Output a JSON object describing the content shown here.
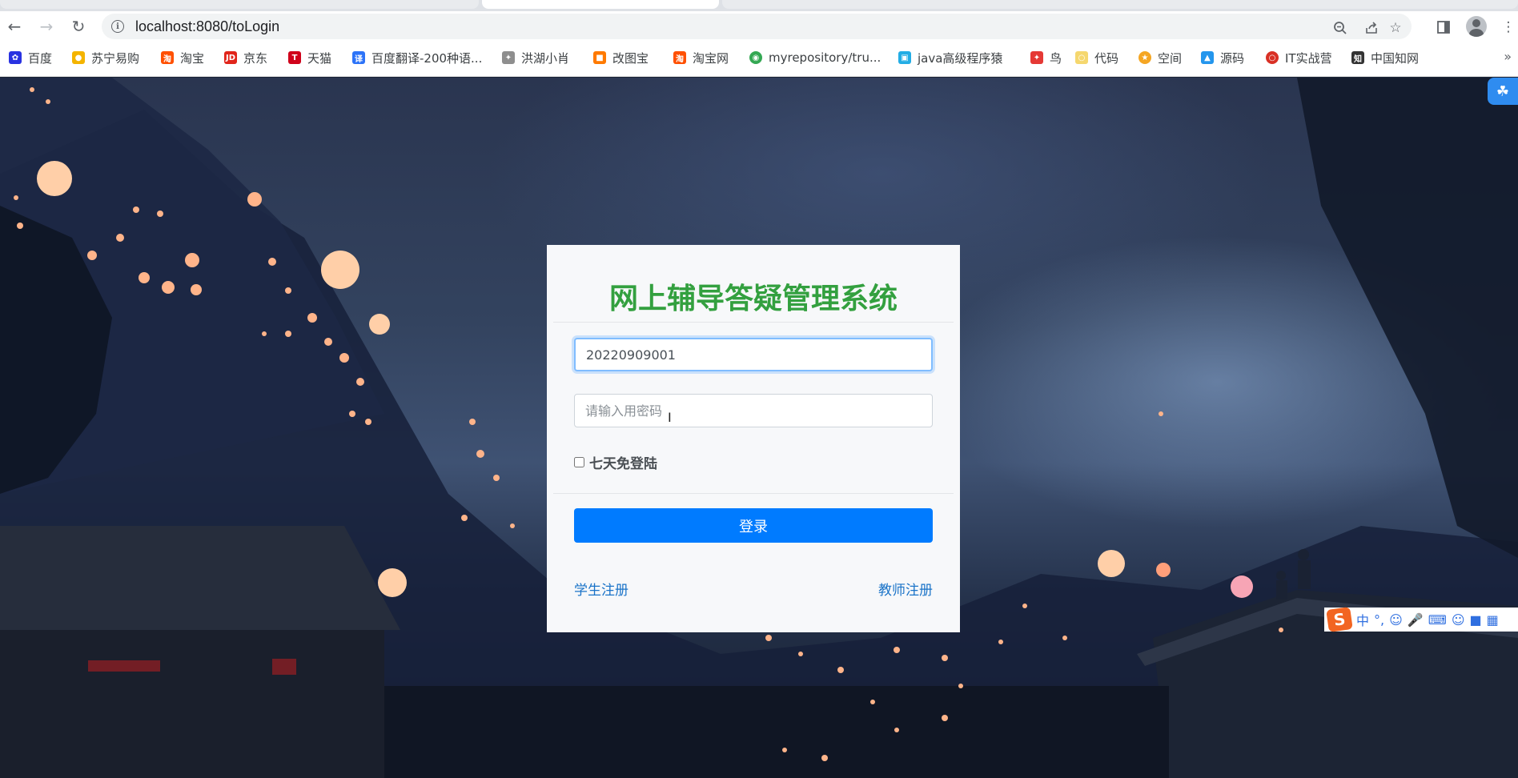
{
  "browser": {
    "url": "localhost:8080/toLogin",
    "bookmarks": [
      {
        "label": "百度",
        "icon": "baidu-paw-icon",
        "color": "#2932e1"
      },
      {
        "label": "苏宁易购",
        "icon": "suning-icon",
        "color": "#f4b400"
      },
      {
        "label": "淘宝",
        "icon": "taobao-icon",
        "color": "#ff5000"
      },
      {
        "label": "京东",
        "icon": "jd-icon",
        "color": "#e1251b"
      },
      {
        "label": "天猫",
        "icon": "tmall-icon",
        "color": "#d0021b"
      },
      {
        "label": "百度翻译-200种语...",
        "icon": "baidu-translate-icon",
        "color": "#2c73f8"
      },
      {
        "label": "洪湖小肖",
        "icon": "bird-icon",
        "color": "#8e8e8e"
      },
      {
        "label": "改图宝",
        "icon": "gaitubao-icon",
        "color": "#ff7a00"
      },
      {
        "label": "淘宝网",
        "icon": "taobao-icon",
        "color": "#ff5000"
      },
      {
        "label": "myrepository/tru...",
        "icon": "chrome-icon",
        "color": "#34a853"
      },
      {
        "label": "java高级程序猿",
        "icon": "bilibili-tv-icon",
        "color": "#23ade5"
      },
      {
        "label": "鸟",
        "icon": "bird-red-icon",
        "color": "#e53935"
      },
      {
        "label": "代码",
        "icon": "code-icon",
        "color": "#f5d76e"
      },
      {
        "label": "空间",
        "icon": "qzone-icon",
        "color": "#f5a623"
      },
      {
        "label": "源码",
        "icon": "docker-icon",
        "color": "#2496ed"
      },
      {
        "label": "IT实战营",
        "icon": "it-icon",
        "color": "#d93025"
      },
      {
        "label": "中国知网",
        "icon": "cnki-icon",
        "color": "#333333"
      }
    ]
  },
  "login": {
    "title": "网上辅导答疑管理系统",
    "username_value": "20220909001",
    "password_placeholder": "请输入用密码",
    "remember_label": "七天免登陆",
    "login_button": "登录",
    "student_register": "学生注册",
    "teacher_register": "教师注册"
  },
  "ime": {
    "brand": "S",
    "lang": "中",
    "punct": "°,"
  },
  "colors": {
    "title_green": "#33a03f",
    "primary_blue": "#007bff",
    "link_blue": "#1a73c8"
  }
}
